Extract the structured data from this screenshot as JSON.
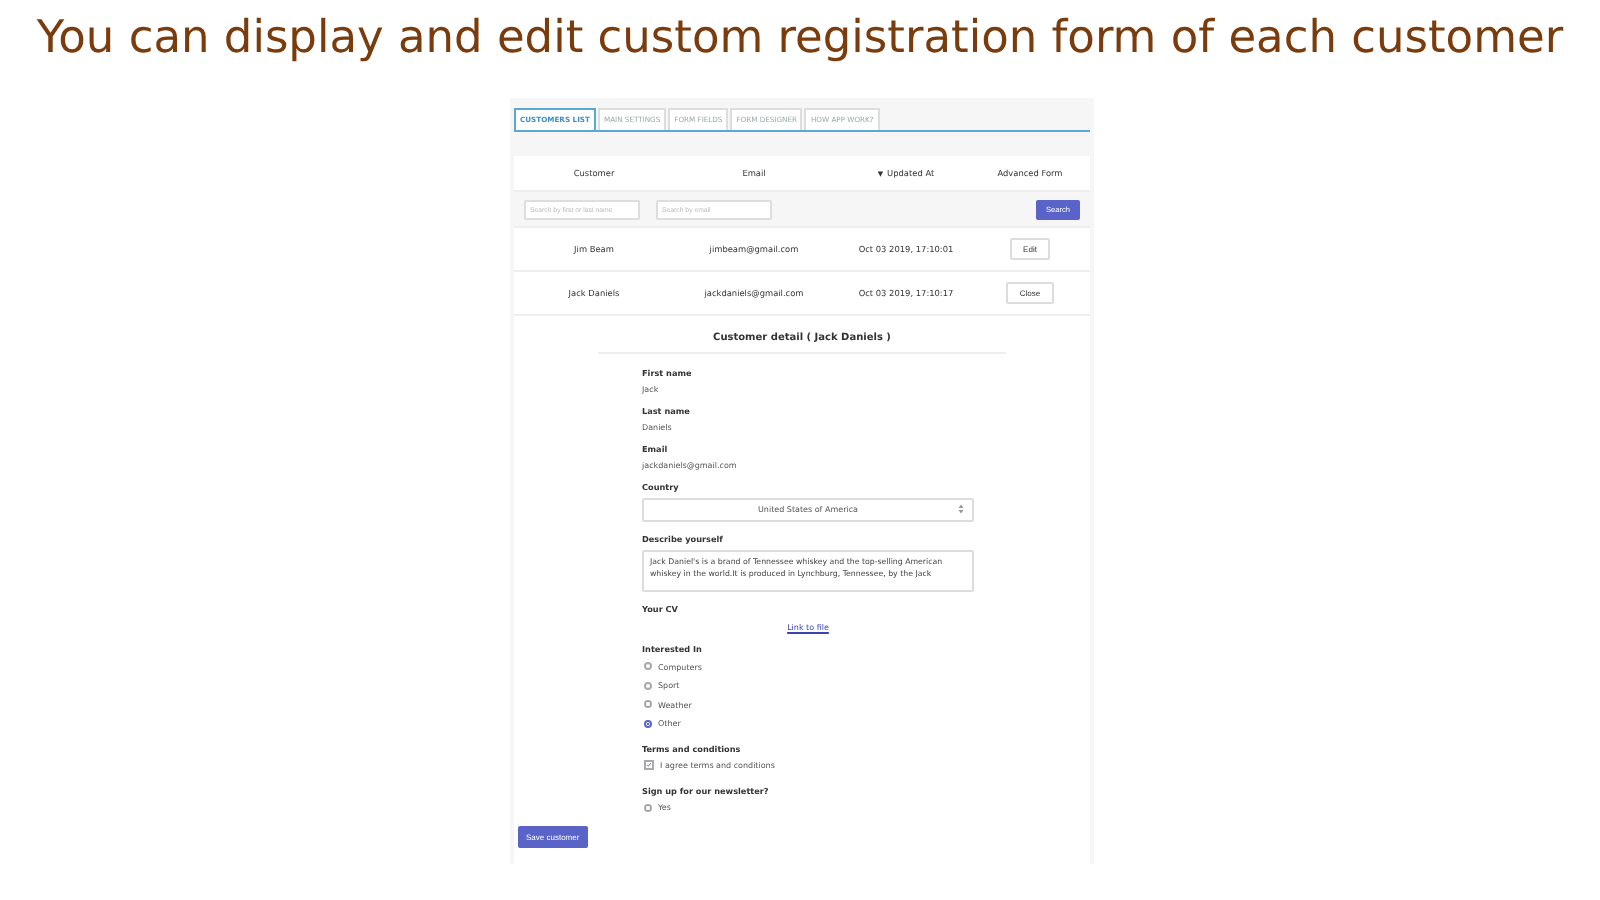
{
  "headline": "You can display and edit custom registration form of each customer",
  "tabs": [
    {
      "label": "CUSTOMERS LIST",
      "selected": true
    },
    {
      "label": "MAIN SETTINGS",
      "selected": false
    },
    {
      "label": "FORM FIELDS",
      "selected": false
    },
    {
      "label": "FORM DESIGNER",
      "selected": false
    },
    {
      "label": "HOW APP WORK?",
      "selected": false
    }
  ],
  "table": {
    "columns": [
      {
        "label": "Customer"
      },
      {
        "label": "Email"
      },
      {
        "label": "Updated At",
        "sort_icon": "▼"
      },
      {
        "label": "Advanced Form"
      }
    ],
    "filters": [
      {
        "placeholder": "Search by first or last name"
      },
      {
        "placeholder": "Search by email"
      }
    ],
    "search_button": "Search",
    "rows": [
      {
        "customer": "Jim Beam",
        "email": "jimbeam@gmail.com",
        "updated": "Oct 03 2019, 17:10:01",
        "action": "Edit"
      },
      {
        "customer": "Jack Daniels",
        "email": "jackdaniels@gmail.com",
        "updated": "Oct 03 2019, 17:10:17",
        "action": "Close"
      }
    ]
  },
  "detail": {
    "title": "Customer detail ( Jack Daniels )",
    "fields": [
      {
        "kind": "text",
        "label": "First name",
        "value": "Jack"
      },
      {
        "kind": "text",
        "label": "Last name",
        "value": "Daniels"
      },
      {
        "kind": "text",
        "label": "Email",
        "value": "jackdaniels@gmail.com"
      },
      {
        "kind": "select",
        "label": "Country",
        "value": "United States of America"
      },
      {
        "kind": "textarea",
        "label": "Describe yourself",
        "value": "Jack Daniel's is a brand of Tennessee whiskey and the top-selling American whiskey in the world.It is produced in Lynchburg, Tennessee, by the Jack"
      },
      {
        "kind": "link",
        "label": "Your CV",
        "value": "Link to file"
      },
      {
        "kind": "radios",
        "label": "Interested In",
        "options": [
          {
            "label": "Computers",
            "selected": false
          },
          {
            "label": "Sport",
            "selected": false
          },
          {
            "label": "Weather",
            "selected": false
          },
          {
            "label": "Other",
            "selected": true
          }
        ]
      },
      {
        "kind": "checkbox",
        "label": "Terms and conditions",
        "options": [
          {
            "label": "I agree terms and conditions",
            "checked": true
          }
        ]
      },
      {
        "kind": "radios",
        "label": "Sign up for our newsletter?",
        "options": [
          {
            "label": "Yes",
            "selected": false
          }
        ]
      }
    ],
    "save_button": "Save customer"
  }
}
